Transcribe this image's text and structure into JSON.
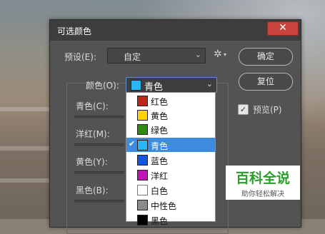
{
  "dialog": {
    "title": "可选颜色",
    "close_label": "✕",
    "preset_label": "预设(E):",
    "preset_value": "自定",
    "ok_label": "确定",
    "reset_label": "复位",
    "preview_label": "预览(P)",
    "preview_checked": true,
    "color_label": "颜色(O):",
    "color_value": "青色",
    "color_value_swatch": "#29b6f6",
    "sliders": [
      {
        "label": "青色(C):"
      },
      {
        "label": "洋红(M):"
      },
      {
        "label": "黄色(Y):"
      },
      {
        "label": "黑色(B):"
      }
    ]
  },
  "color_menu": {
    "items": [
      {
        "label": "红色",
        "swatch": "#c0261a",
        "selected": false
      },
      {
        "label": "黄色",
        "swatch": "#ffd400",
        "selected": false
      },
      {
        "label": "绿色",
        "swatch": "#2e8a10",
        "selected": false
      },
      {
        "label": "青色",
        "swatch": "#29b6f6",
        "selected": true
      },
      {
        "label": "蓝色",
        "swatch": "#1554e8",
        "selected": false
      },
      {
        "label": "洋红",
        "swatch": "#c113b6",
        "selected": false
      },
      {
        "label": "白色",
        "swatch": "#ffffff",
        "selected": false
      },
      {
        "label": "中性色",
        "swatch": "#8c8c8c",
        "selected": false
      },
      {
        "label": "黑色",
        "swatch": "#000000",
        "selected": false
      }
    ]
  },
  "watermark": {
    "main": "百科全说",
    "sub": "助你轻松解决"
  },
  "colors": {
    "dialog_bg": "#535353",
    "titlebar_bg": "#3d3d3d",
    "selection": "#3d8bdc",
    "close_button": "#c8433b",
    "watermark_green": "#2a9d2a"
  }
}
